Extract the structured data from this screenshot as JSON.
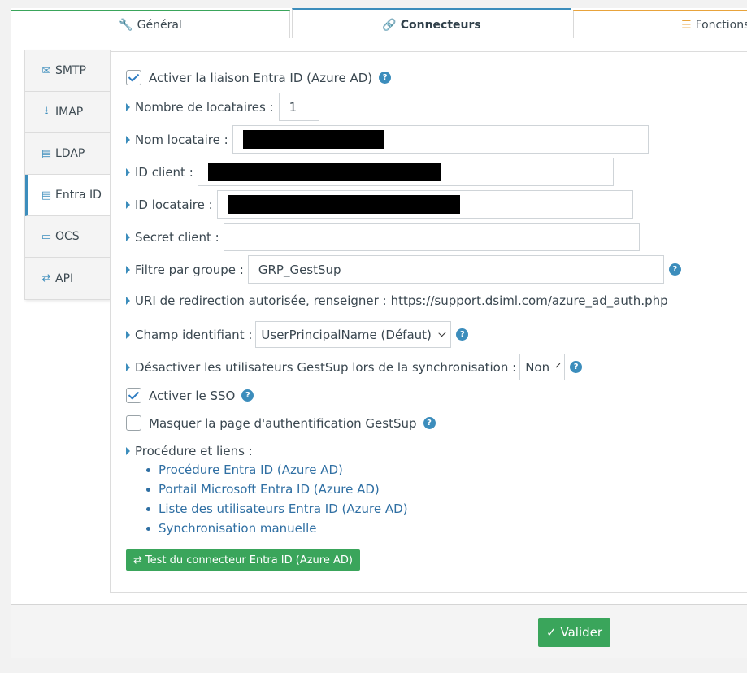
{
  "top_tabs": [
    {
      "label": "Général",
      "icon": "wrench-icon"
    },
    {
      "label": "Connecteurs",
      "icon": "link-icon"
    },
    {
      "label": "Fonctions",
      "icon": "list-check-icon"
    }
  ],
  "side_tabs": [
    {
      "label": "SMTP",
      "icon": "envelope-icon"
    },
    {
      "label": "IMAP",
      "icon": "download-icon"
    },
    {
      "label": "LDAP",
      "icon": "book-icon"
    },
    {
      "label": "Entra ID",
      "icon": "book-icon",
      "active": true
    },
    {
      "label": "OCS",
      "icon": "desktop-icon"
    },
    {
      "label": "API",
      "icon": "exchange-icon"
    }
  ],
  "form": {
    "enable_label": "Activer la liaison Entra ID (Azure AD)",
    "enable_checked": true,
    "tenants_label": "Nombre de locataires :",
    "tenants_value": "1",
    "tenant_name_label": "Nom locataire :",
    "client_id_label": "ID client :",
    "tenant_id_label": "ID locataire :",
    "client_secret_label": "Secret client :",
    "client_secret_value": "",
    "group_filter_label": "Filtre par groupe :",
    "group_filter_value": "GRP_GestSup",
    "redirect_label": "URI de redirection autorisée, renseigner :",
    "redirect_value": "https://support.dsiml.com/azure_ad_auth.php",
    "id_field_label": "Champ identifiant :",
    "id_field_value": "UserPrincipalName (Défaut)",
    "disable_users_label": "Désactiver les utilisateurs GestSup lors de la synchronisation :",
    "disable_users_value": "Non",
    "sso_label": "Activer le SSO",
    "sso_checked": true,
    "hide_auth_label": "Masquer la page d'authentification GestSup",
    "hide_auth_checked": false,
    "procedure_label": "Procédure et liens :",
    "links": [
      "Procédure Entra ID (Azure AD)",
      "Portail Microsoft Entra ID (Azure AD)",
      "Liste des utilisateurs Entra ID (Azure AD)",
      "Synchronisation manuelle"
    ],
    "test_button": "Test du connecteur Entra ID (Azure AD)"
  },
  "footer": {
    "submit_label": "Valider"
  },
  "colors": {
    "accent": "#3c8dbc",
    "success": "#3aa55b",
    "warning": "#e8a33b"
  }
}
